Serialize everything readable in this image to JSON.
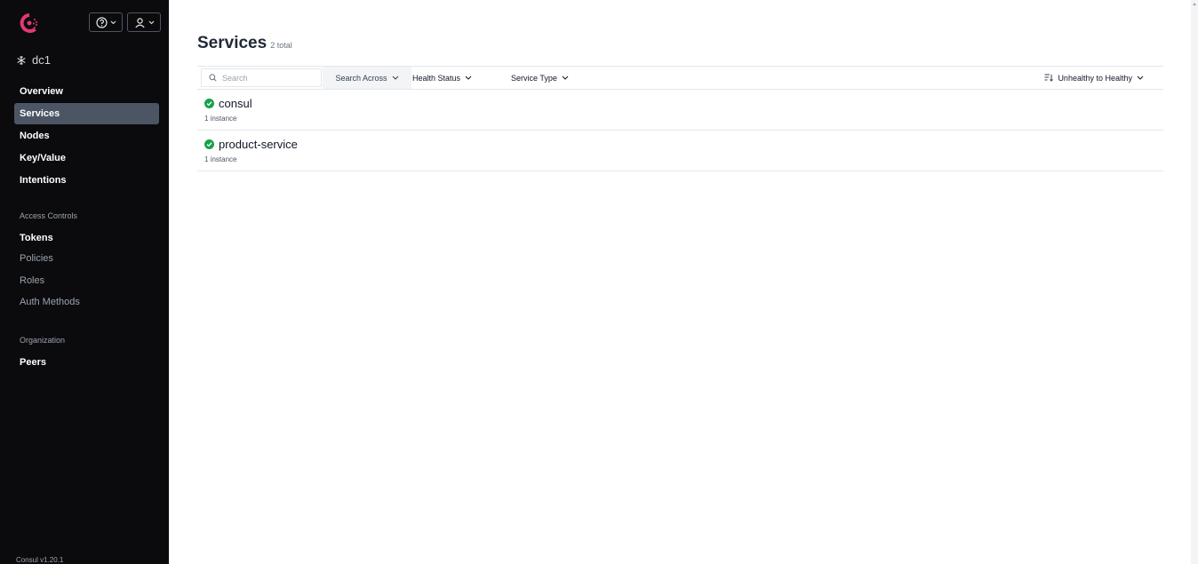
{
  "app": {
    "version": "Consul v1.20.1"
  },
  "colors": {
    "brand": "#e03875",
    "sidebar_bg": "#0b0b0d",
    "healthy": "#16a34a"
  },
  "header": {
    "help_icon": "help-circle-icon",
    "user_icon": "user-icon"
  },
  "datacenter": {
    "name": "dc1",
    "icon": "datacenter-icon"
  },
  "nav": {
    "main": [
      {
        "label": "Overview"
      },
      {
        "label": "Services"
      },
      {
        "label": "Nodes"
      },
      {
        "label": "Key/Value"
      },
      {
        "label": "Intentions"
      }
    ],
    "access_controls": {
      "heading": "Access Controls",
      "items": [
        {
          "label": "Tokens"
        },
        {
          "label": "Policies"
        },
        {
          "label": "Roles"
        },
        {
          "label": "Auth Methods"
        }
      ]
    },
    "organization": {
      "heading": "Organization",
      "items": [
        {
          "label": "Peers"
        }
      ]
    }
  },
  "page": {
    "title": "Services",
    "total": "2 total"
  },
  "filters": {
    "search_placeholder": "Search",
    "search_across": "Search Across",
    "health_status": "Health Status",
    "service_type": "Service Type",
    "sort": "Unhealthy to Healthy"
  },
  "services": [
    {
      "name": "consul",
      "instances": "1 instance",
      "status": "healthy"
    },
    {
      "name": "product-service",
      "instances": "1 instance",
      "status": "healthy"
    }
  ]
}
